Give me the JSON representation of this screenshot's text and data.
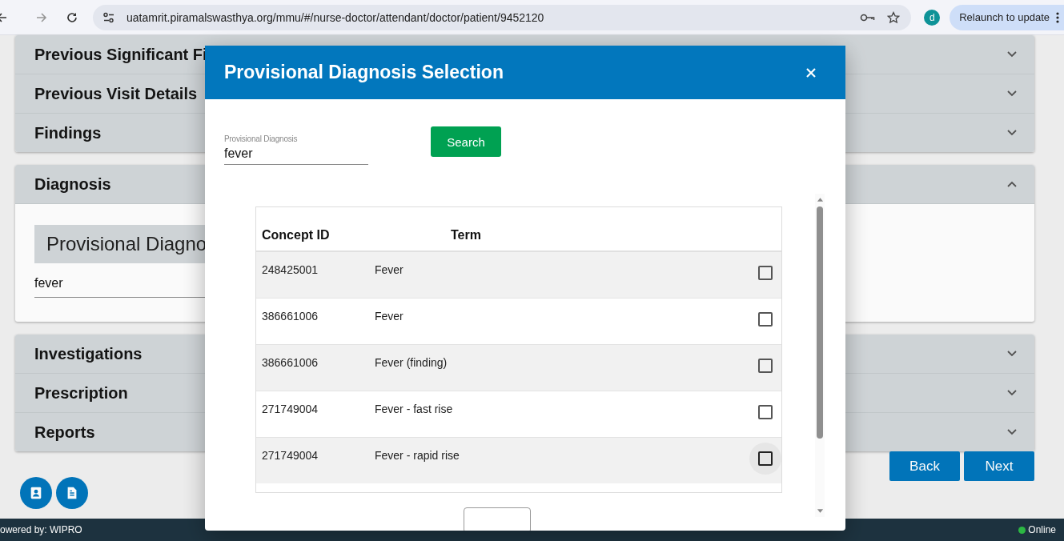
{
  "browser": {
    "url": "uatamrit.piramalswasthya.org/mmu/#/nurse-doctor/attendant/doctor/patient/9452120",
    "profile_initial": "d",
    "relaunch_label": "Relaunch to update"
  },
  "accordions_top": [
    {
      "title": "Previous Significant Fi",
      "expanded": false
    },
    {
      "title": "Previous Visit Details",
      "expanded": false
    },
    {
      "title": "Findings",
      "expanded": false
    }
  ],
  "diagnosis": {
    "title": "Diagnosis",
    "expanded": true,
    "subheading": "Provisional Diagno",
    "value": "fever"
  },
  "accordions_bottom": [
    {
      "title": "Investigations",
      "expanded": false
    },
    {
      "title": "Prescription",
      "expanded": false
    },
    {
      "title": "Reports",
      "expanded": false
    }
  ],
  "actions": [
    "Back",
    "Next"
  ],
  "footer": {
    "left": "owered by: WIPRO",
    "status": "Online"
  },
  "modal": {
    "title": "Provisional Diagnosis Selection",
    "field": {
      "label": "Provisional Diagnosis",
      "value": "fever"
    },
    "search_label": "Search",
    "table": {
      "columns": [
        "Concept ID",
        "Term"
      ],
      "rows": [
        {
          "id": "248425001",
          "term": "Fever",
          "checked": false,
          "hovered": false
        },
        {
          "id": "386661006",
          "term": "Fever",
          "checked": false,
          "hovered": false
        },
        {
          "id": "386661006",
          "term": "Fever (finding)",
          "checked": false,
          "hovered": false
        },
        {
          "id": "271749004",
          "term": "Fever - fast rise",
          "checked": false,
          "hovered": false
        },
        {
          "id": "271749004",
          "term": "Fever - rapid rise",
          "checked": false,
          "hovered": true
        }
      ]
    }
  }
}
